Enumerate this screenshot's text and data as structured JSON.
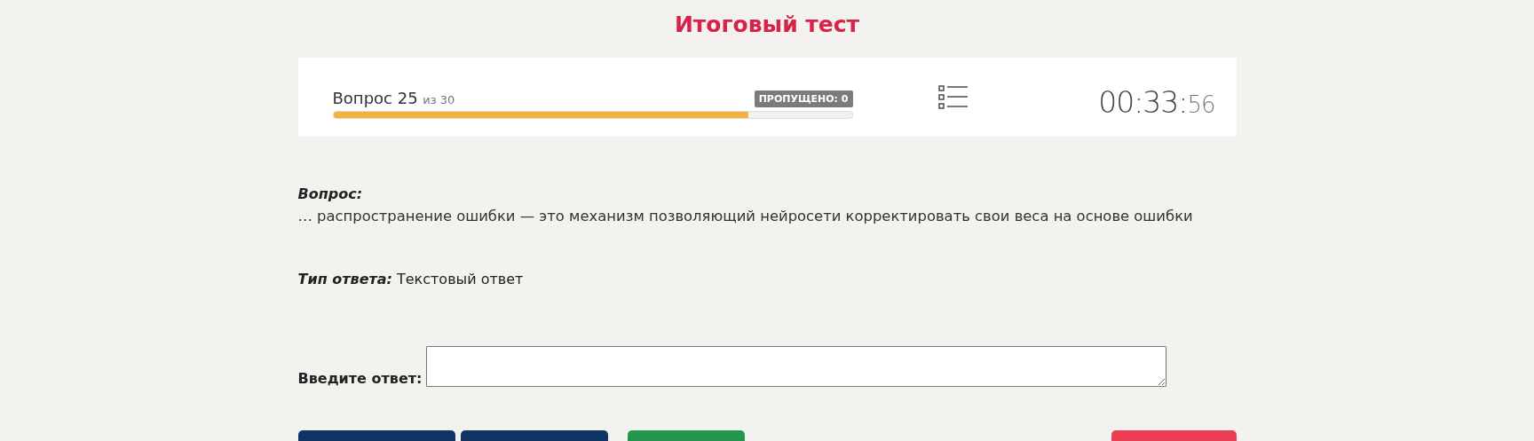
{
  "title": "Итоговый тест",
  "progress": {
    "label": "Вопрос 25",
    "of": "из 30",
    "level": 0.8,
    "skipped": "ПРОПУЩЕНО: 0"
  },
  "timer": {
    "main": "00:33:",
    "seconds": "56"
  },
  "question": {
    "label": "Вопрос:",
    "text": "… распространение ошибки — это механизм позволяющий нейросети корректировать свои веса на основе ошибки"
  },
  "answer_type": {
    "label": "Тип ответа:",
    "value": "Текстовый ответ"
  },
  "answer": {
    "label": "Введите ответ:"
  },
  "buttons": [
    {
      "color": "#0f3465"
    },
    {
      "color": "#0f3465"
    },
    {
      "color": "#23964e"
    },
    {
      "color": "#ee3e53"
    }
  ]
}
